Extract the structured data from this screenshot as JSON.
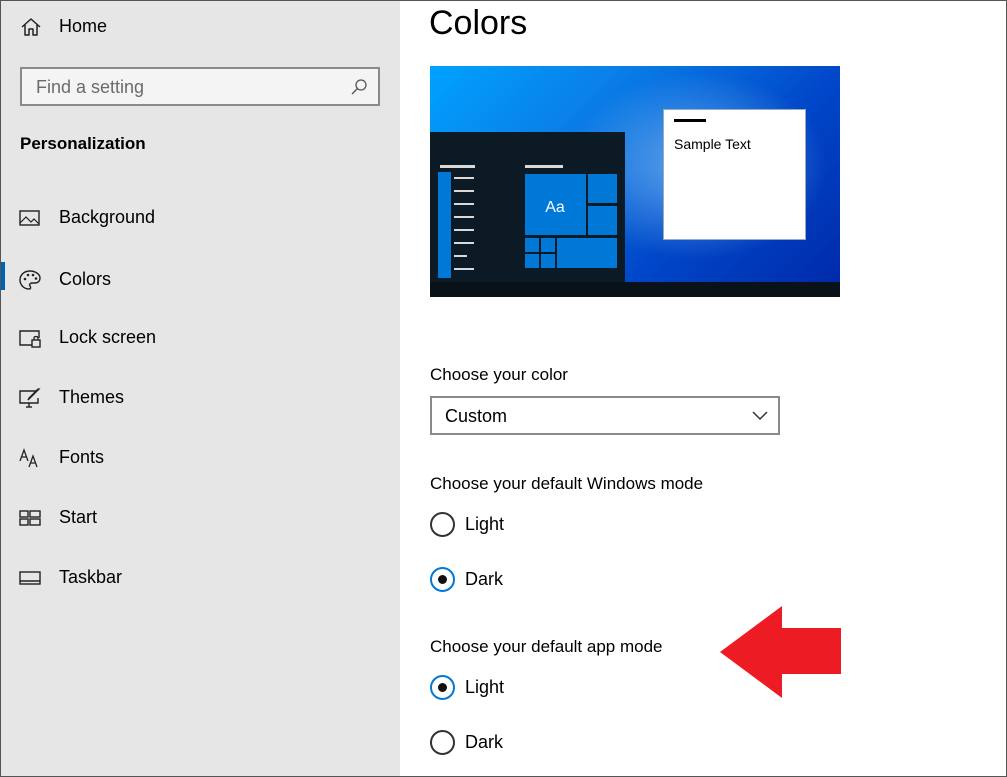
{
  "sidebar": {
    "home_label": "Home",
    "search_placeholder": "Find a setting",
    "section_title": "Personalization",
    "items": [
      {
        "label": "Background",
        "icon": "image-icon"
      },
      {
        "label": "Colors",
        "icon": "palette-icon",
        "selected": true
      },
      {
        "label": "Lock screen",
        "icon": "lock-screen-icon"
      },
      {
        "label": "Themes",
        "icon": "themes-icon"
      },
      {
        "label": "Fonts",
        "icon": "fonts-icon"
      },
      {
        "label": "Start",
        "icon": "start-icon"
      },
      {
        "label": "Taskbar",
        "icon": "taskbar-icon"
      }
    ]
  },
  "main": {
    "title": "Colors",
    "preview": {
      "sample_text": "Sample Text",
      "tile_text": "Aa"
    },
    "choose_color": {
      "label": "Choose your color",
      "selected": "Custom"
    },
    "windows_mode": {
      "label": "Choose your default Windows mode",
      "options": [
        {
          "label": "Light",
          "checked": false
        },
        {
          "label": "Dark",
          "checked": true
        }
      ]
    },
    "app_mode": {
      "label": "Choose your default app mode",
      "options": [
        {
          "label": "Light",
          "checked": true
        },
        {
          "label": "Dark",
          "checked": false
        }
      ]
    }
  },
  "colors": {
    "accent": "#0078d7",
    "sidebar_bg": "#e6e6e6",
    "annotation_arrow": "#ed1c24"
  }
}
